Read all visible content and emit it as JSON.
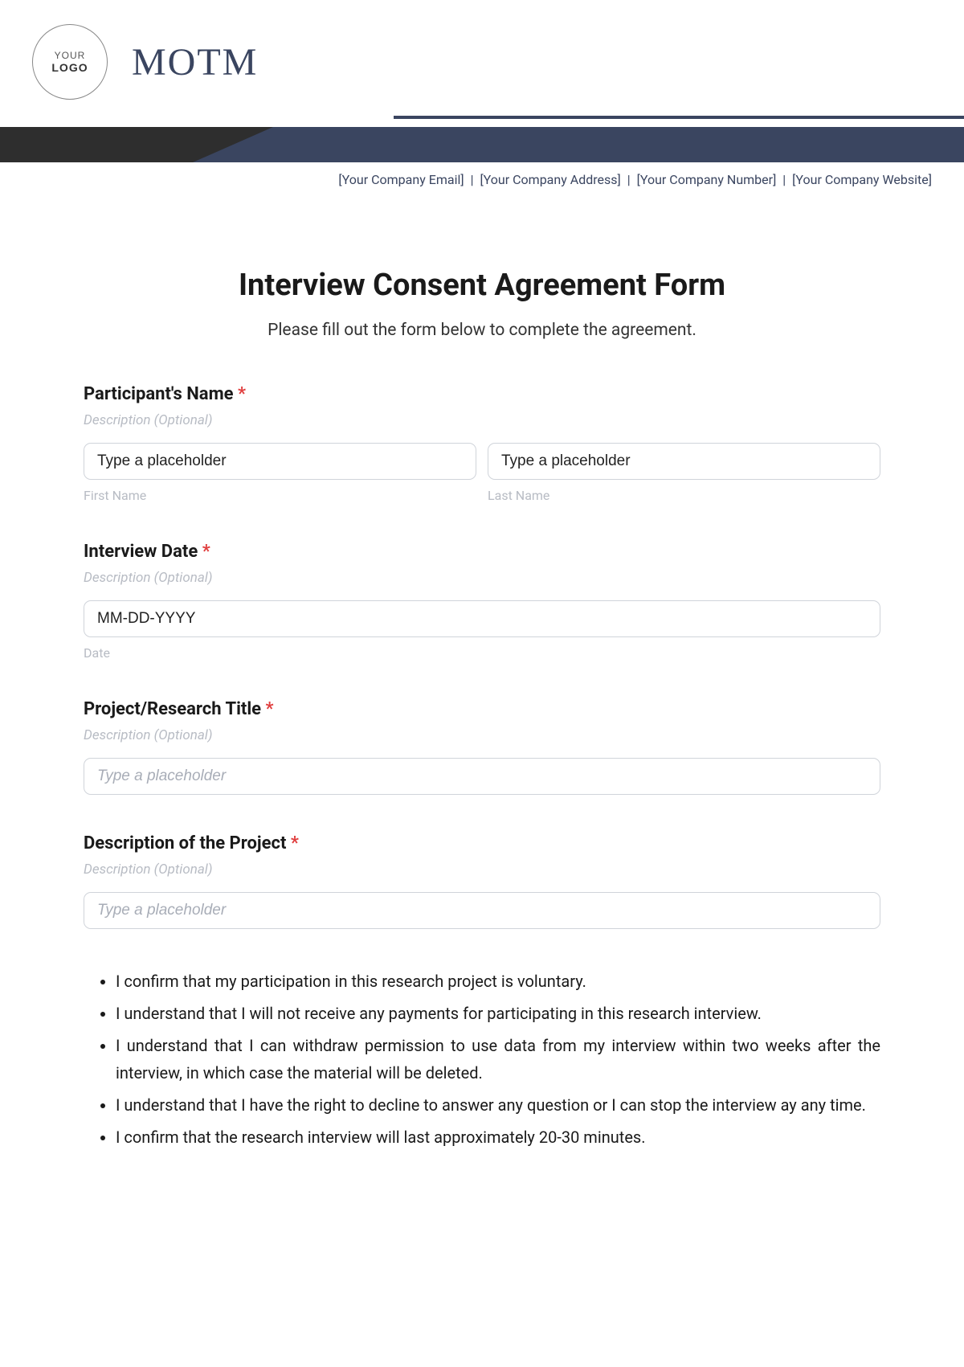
{
  "header": {
    "logo_line1": "YOUR",
    "logo_line2": "LOGO",
    "brand": "MOTM",
    "contact": {
      "email": "[Your Company Email]",
      "address": "[Your Company Address]",
      "number": "[Your Company Number]",
      "website": "[Your Company Website]"
    }
  },
  "title": "Interview Consent Agreement Form",
  "subtitle": "Please fill out the form below to complete the agreement.",
  "fields": {
    "participant_name": {
      "label": "Participant's Name",
      "desc": "Description (Optional)",
      "first_placeholder": "Type a placeholder",
      "first_sub": "First Name",
      "last_placeholder": "Type a placeholder",
      "last_sub": "Last Name"
    },
    "interview_date": {
      "label": "Interview Date",
      "desc": "Description (Optional)",
      "placeholder": "MM-DD-YYYY",
      "sub": "Date"
    },
    "project_title": {
      "label": "Project/Research Title",
      "desc": "Description (Optional)",
      "placeholder": "Type a placeholder"
    },
    "project_desc": {
      "label": "Description of the Project",
      "desc": "Description (Optional)",
      "placeholder": "Type a placeholder"
    }
  },
  "consent_items": [
    "I confirm that my participation in this research project is voluntary.",
    "I understand that I will not receive any payments for participating in this research interview.",
    "I understand that I can withdraw permission to use data from my interview within two weeks after the interview, in which case the material will be deleted.",
    "I understand that I have the right to decline to answer any question or I can stop the interview ay any time.",
    "I confirm that the research interview will last approximately 20-30 minutes."
  ],
  "required_marker": "*"
}
